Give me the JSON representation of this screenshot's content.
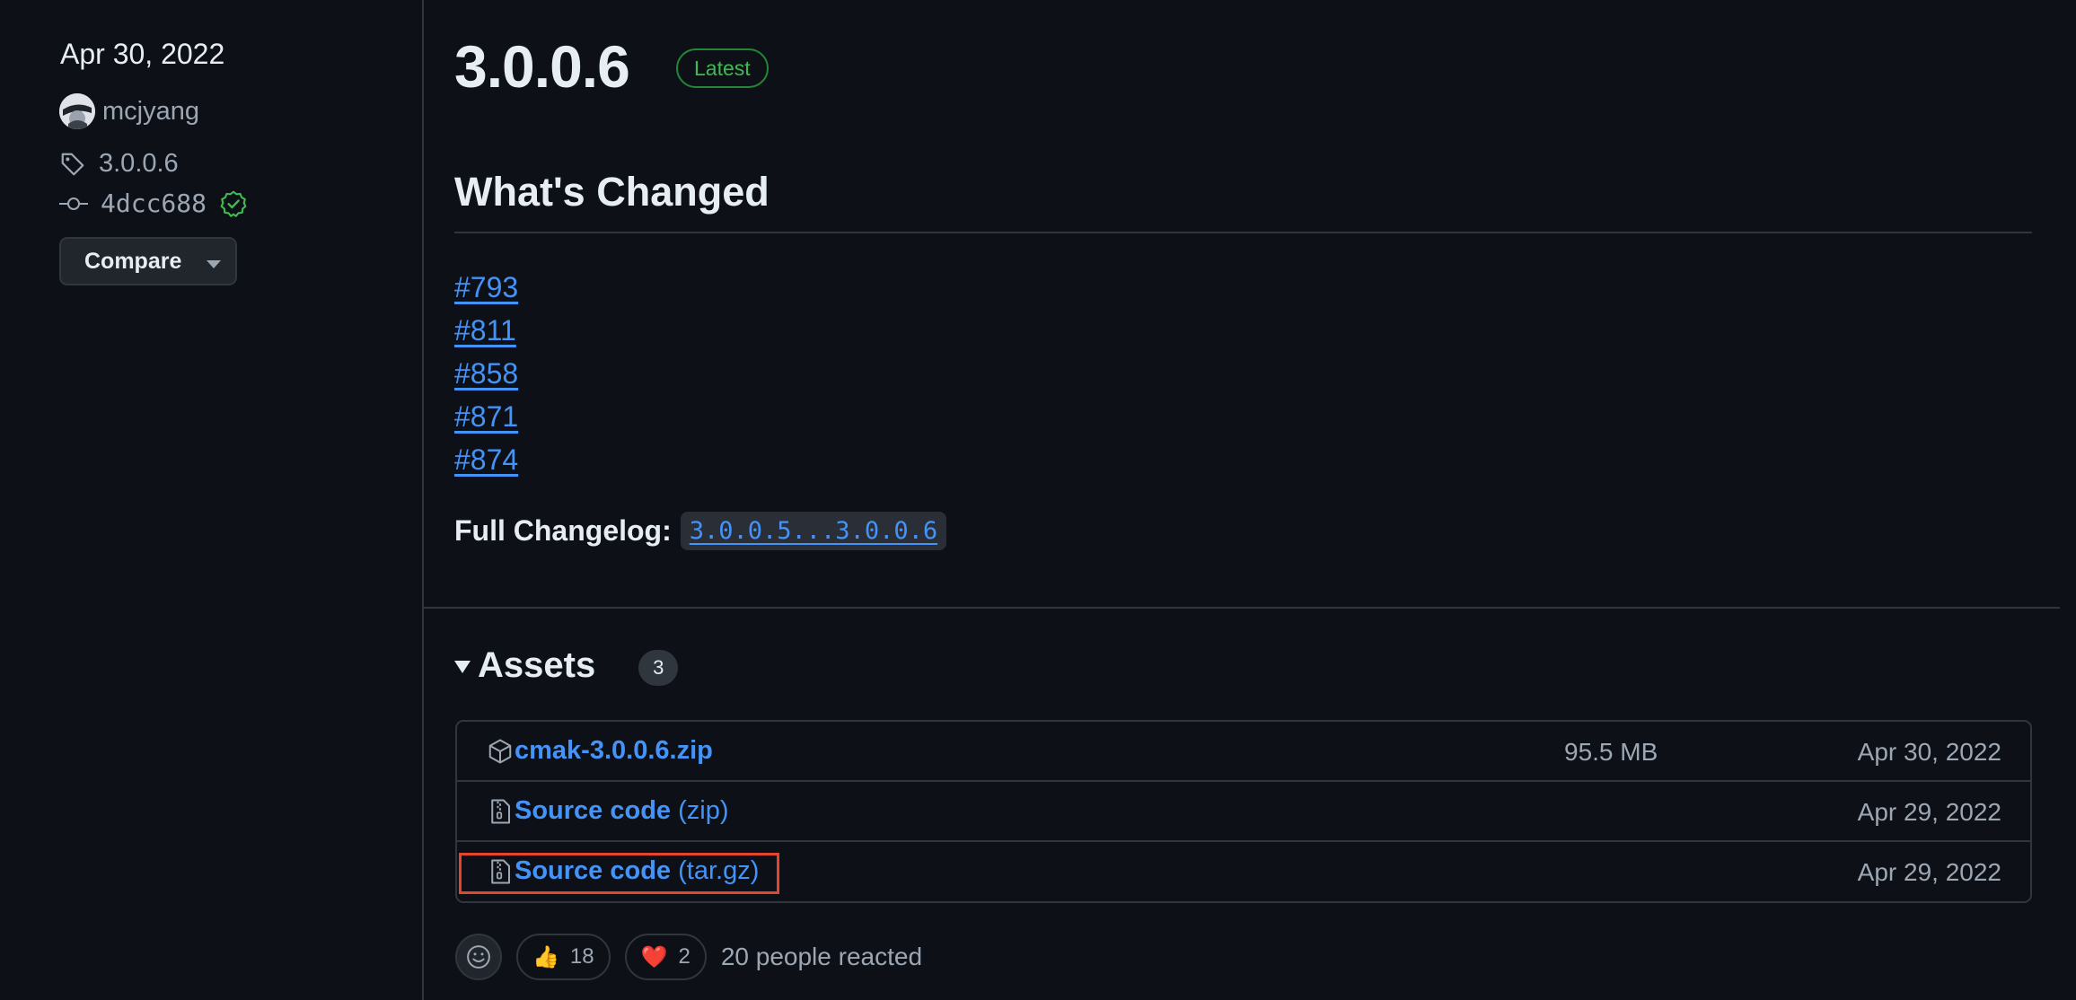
{
  "sidebar": {
    "date": "Apr 30, 2022",
    "author": "mcjyang",
    "tag": "3.0.0.6",
    "commit": "4dcc688",
    "compare_label": "Compare"
  },
  "release": {
    "title": "3.0.0.6",
    "badge": "Latest",
    "heading": "What's Changed",
    "pull_requests": [
      "#793",
      "#811",
      "#858",
      "#871",
      "#874"
    ],
    "changelog_label": "Full Changelog:",
    "changelog_range": "3.0.0.5...3.0.0.6"
  },
  "assets": {
    "title": "Assets",
    "count": "3",
    "items": [
      {
        "name": "cmak-3.0.0.6.zip",
        "suffix": "",
        "size": "95.5 MB",
        "date": "Apr 30, 2022",
        "icon": "package-icon"
      },
      {
        "name": "Source code",
        "suffix": "(zip)",
        "size": "",
        "date": "Apr 29, 2022",
        "icon": "file-zip-icon"
      },
      {
        "name": "Source code",
        "suffix": "(tar.gz)",
        "size": "",
        "date": "Apr 29, 2022",
        "icon": "file-zip-icon"
      }
    ]
  },
  "reactions": {
    "items": [
      {
        "emoji": "👍",
        "count": "18"
      },
      {
        "emoji": "❤️",
        "count": "2"
      }
    ],
    "summary": "20 people reacted"
  },
  "colors": {
    "background": "#0d1117",
    "link": "#4493f8",
    "muted": "#9da7b3",
    "latest_green": "#3fb950",
    "highlight": "#e5452c"
  }
}
